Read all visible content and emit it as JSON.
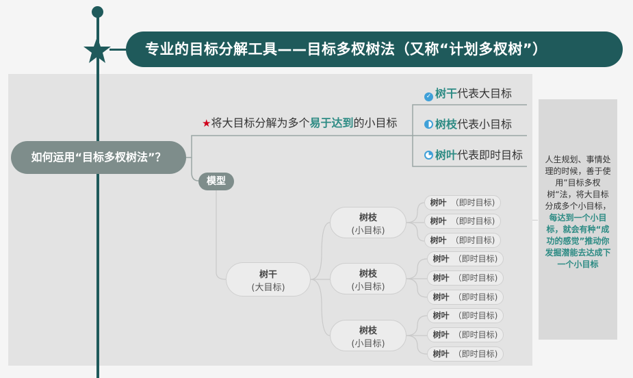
{
  "title": "专业的目标分解工具——目标多杈树法（又称“计划多杈树”）",
  "root": "如何运用“目标多杈树法”？",
  "branch1": {
    "prefix": "将大目标分解为多个",
    "highlight": "易于达到",
    "suffix": "的小目标"
  },
  "legend": [
    {
      "icon": "check-circle-icon",
      "hl": "树干",
      "text": "代表大目标"
    },
    {
      "icon": "half-circle-icon",
      "hl": "树枝",
      "text": "代表小目标"
    },
    {
      "icon": "quarter-circle-icon",
      "hl": "树叶",
      "text": "代表即时目标"
    }
  ],
  "model": "模型",
  "tree": {
    "trunk": {
      "main": "树干",
      "sub": "(大目标)"
    },
    "branch": {
      "main": "树枝",
      "sub": "(小目标)"
    },
    "leaf": {
      "main": "树叶",
      "sub": "（即时目标)"
    }
  },
  "note": {
    "plain": "人生规划、事情处理的时候，善于使用”目标多杈树“法，将大目标分成多个小目标，",
    "highlight": "每达到一个小目标，就会有种“成功的感觉”推动你发掘潜能去达成下一个小目标"
  },
  "colors": {
    "primary": "#1f5a5b",
    "accent": "#2d8b84",
    "node": "#7e8d8b",
    "star": "#d0021b"
  }
}
